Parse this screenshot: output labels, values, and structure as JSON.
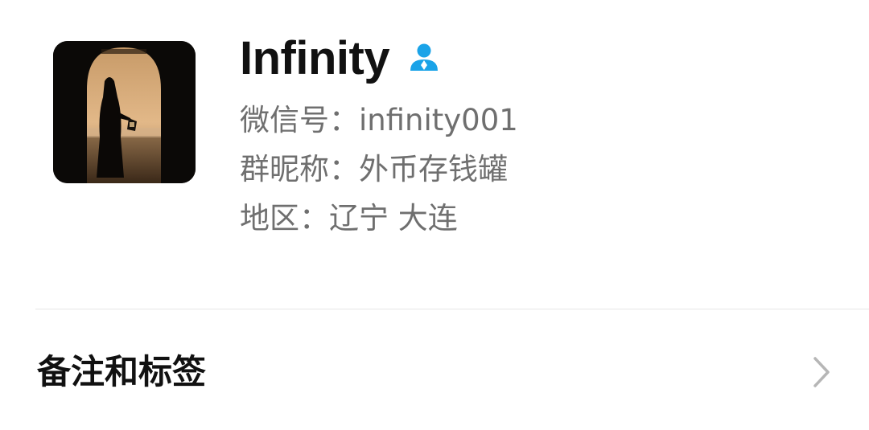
{
  "profile": {
    "nickname": "Infinity",
    "icons": {
      "contact": "contact-person-icon",
      "chevron": "chevron-right-icon"
    },
    "colors": {
      "contact_icon": "#1aa3e8",
      "secondary_text": "#6f6f6f"
    },
    "wechat_id_line": "微信号：infinity001",
    "group_nickname_line": "群昵称：外币存钱罐",
    "region_line": "地区：辽宁 大连"
  },
  "menu": {
    "remarks_and_tags_label": "备注和标签"
  }
}
